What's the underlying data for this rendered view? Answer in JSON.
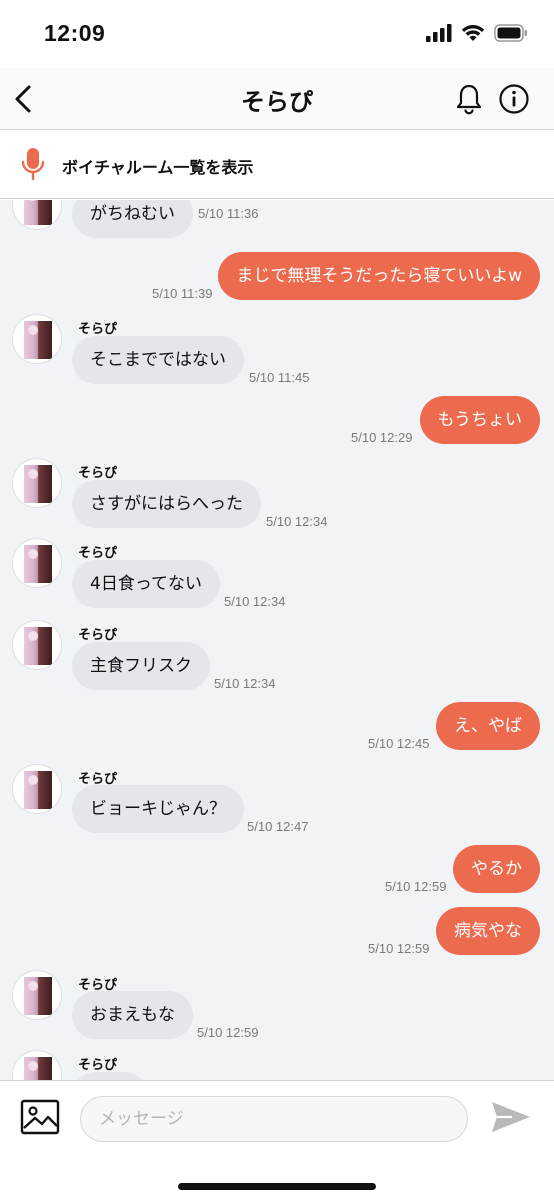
{
  "status_bar": {
    "time": "12:09"
  },
  "header": {
    "title": "そらぴ"
  },
  "voice_banner": {
    "label": "ボイチャルーム一覧を表示"
  },
  "messages": [
    {
      "direction": "in",
      "sender": "",
      "text": "がちねむい",
      "timestamp": "5/10 11:36"
    },
    {
      "direction": "out",
      "text": "まじで無理そうだったら寝ていいよw",
      "timestamp": "5/10 11:39"
    },
    {
      "direction": "in",
      "sender": "そらぴ",
      "text": "そこまでではない",
      "timestamp": "5/10 11:45"
    },
    {
      "direction": "out",
      "text": "もうちょい",
      "timestamp": "5/10 12:29"
    },
    {
      "direction": "in",
      "sender": "そらぴ",
      "text": "さすがにはらへった",
      "timestamp": "5/10 12:34"
    },
    {
      "direction": "in",
      "sender": "そらぴ",
      "text": "4日食ってない",
      "timestamp": "5/10 12:34"
    },
    {
      "direction": "in",
      "sender": "そらぴ",
      "text": "主食フリスク",
      "timestamp": "5/10 12:34"
    },
    {
      "direction": "out",
      "text": "え、やば",
      "timestamp": "5/10 12:45"
    },
    {
      "direction": "in",
      "sender": "そらぴ",
      "text": "ビョーキじゃん？",
      "timestamp": "5/10 12:47"
    },
    {
      "direction": "out",
      "text": "やるか",
      "timestamp": "5/10 12:59"
    },
    {
      "direction": "out",
      "text": "病気やな",
      "timestamp": "5/10 12:59"
    },
    {
      "direction": "in",
      "sender": "そらぴ",
      "text": "おまえもな",
      "timestamp": "5/10 12:59"
    },
    {
      "direction": "in",
      "sender": "そらぴ",
      "text": "",
      "timestamp": ""
    }
  ],
  "composer": {
    "placeholder": "メッセージ"
  },
  "colors": {
    "accent": "#ec6a4d",
    "incoming_bubble": "#e4e6eb",
    "chat_background": "#f2f3f7"
  },
  "icons": [
    "back-chevron-icon",
    "bell-icon",
    "info-icon",
    "microphone-icon",
    "image-icon",
    "send-icon"
  ]
}
